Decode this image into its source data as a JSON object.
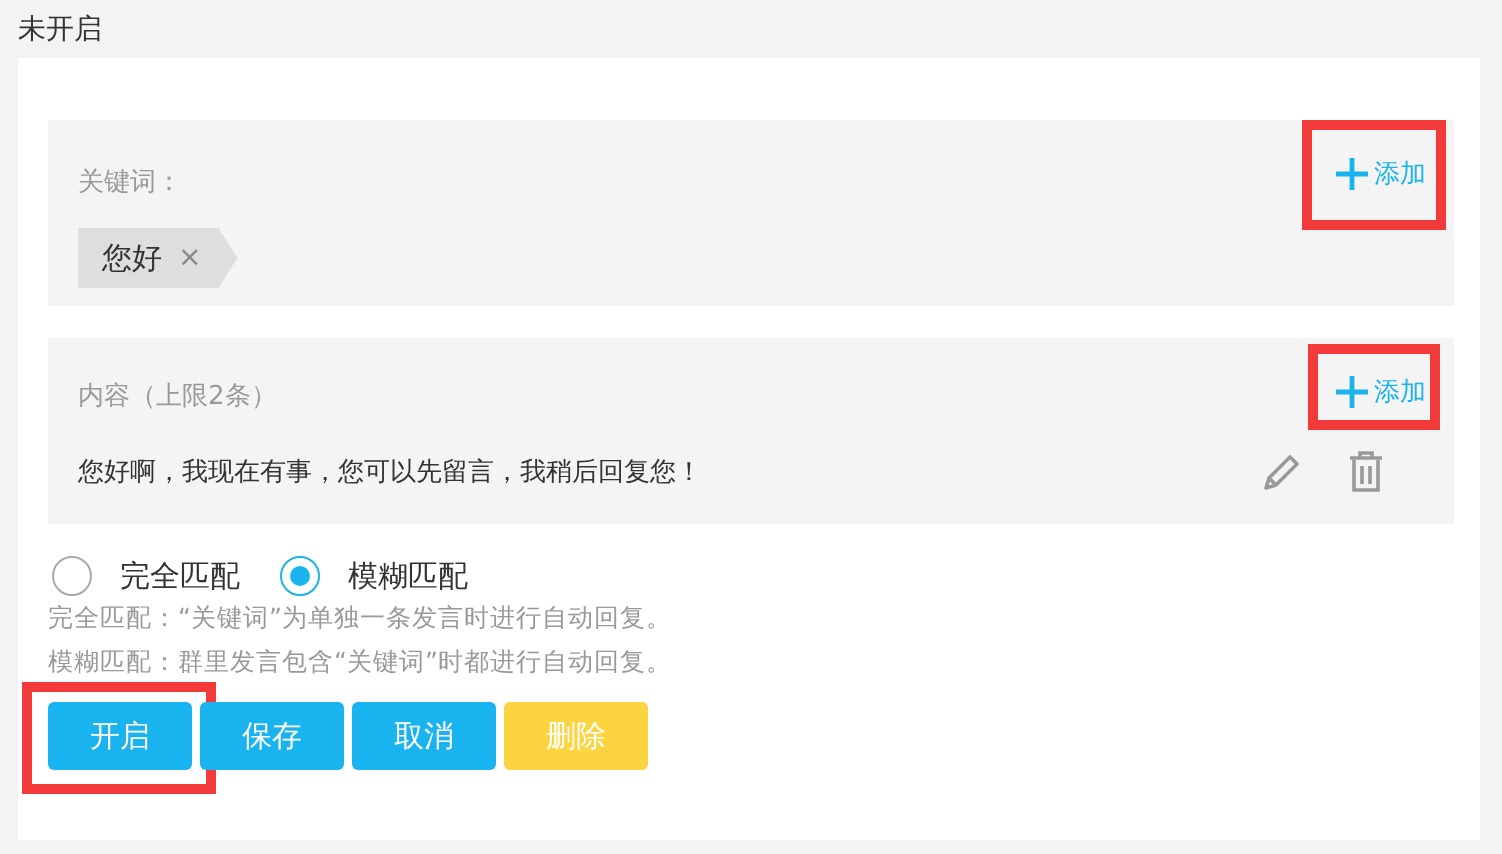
{
  "status": "未开启",
  "keywords": {
    "label": "关键词：",
    "add": {
      "label": "添加",
      "highlighted": true
    },
    "tags": [
      {
        "text": "您好",
        "remove": "×"
      }
    ]
  },
  "content": {
    "label": "内容（上限2条）",
    "add": {
      "label": "添加",
      "highlighted": true
    },
    "items": [
      {
        "text": "您好啊，我现在有事，您可以先留言，我稍后回复您！"
      }
    ]
  },
  "match_modes": [
    {
      "label": "完全匹配",
      "selected": false
    },
    {
      "label": "模糊匹配",
      "selected": true
    }
  ],
  "hints": [
    "完全匹配：“关键词”为单独一条发言时进行自动回复。",
    "模糊匹配：群里发言包含“关键词”时都进行自动回复。"
  ],
  "buttons": [
    {
      "label": "开启",
      "kind": "primary",
      "highlighted": true
    },
    {
      "label": "保存",
      "kind": "primary",
      "highlighted": false
    },
    {
      "label": "取消",
      "kind": "primary",
      "highlighted": false
    },
    {
      "label": "删除",
      "kind": "warning",
      "highlighted": false
    }
  ]
}
